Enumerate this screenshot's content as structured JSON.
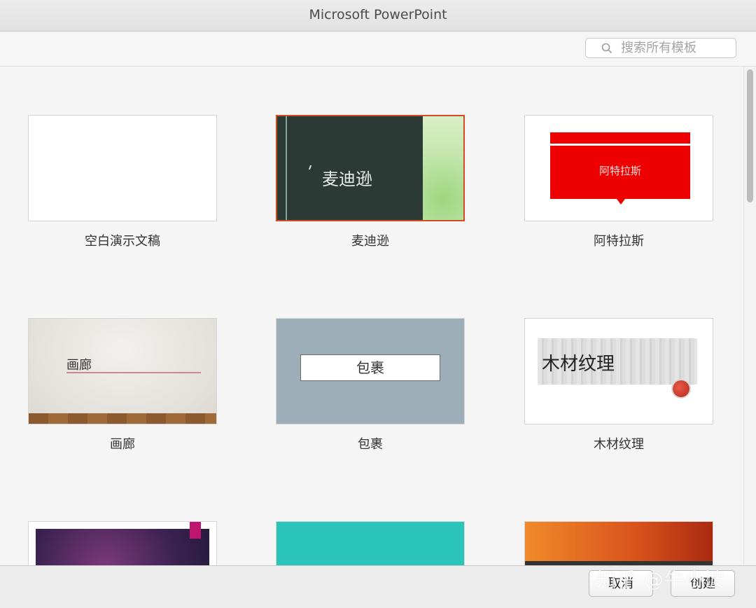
{
  "window": {
    "title": "Microsoft PowerPoint"
  },
  "search": {
    "placeholder": "搜索所有模板"
  },
  "templates": [
    {
      "id": "blank",
      "label": "空白演示文稿"
    },
    {
      "id": "madison",
      "label": "麦迪逊",
      "thumb_text": "麦迪逊",
      "selected": true
    },
    {
      "id": "atlas",
      "label": "阿特拉斯",
      "thumb_text": "阿特拉斯"
    },
    {
      "id": "gallery",
      "label": "画廊",
      "thumb_text": "画廊"
    },
    {
      "id": "package",
      "label": "包裹",
      "thumb_text": "包裹"
    },
    {
      "id": "wood-type",
      "label": "木材纹理",
      "thumb_text": "木材纹理"
    }
  ],
  "partial_templates": [
    "purple-template",
    "teal-template",
    "orange-template"
  ],
  "footer": {
    "cancel_label": "取消",
    "create_label": "创建"
  },
  "watermark": "知乎 @牛小波",
  "colors": {
    "selection": "#d34b23"
  }
}
